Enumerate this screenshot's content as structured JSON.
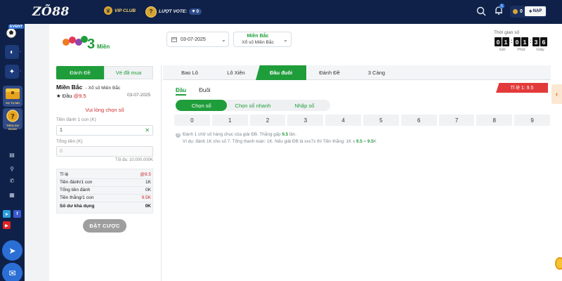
{
  "header": {
    "brand": "ZÕ88",
    "vip_label": "VIP CLUB",
    "vote_label": "LƯỢT VOTE:",
    "vote_count": "0",
    "notification_count": "5",
    "balance": "0",
    "topup_label": "NẠP"
  },
  "siderail": {
    "event_label": "EVENT",
    "promo1_label": "SỰ TỤ MÙ",
    "promo2_label": "THEA DỰ ĐOÁN"
  },
  "lottery": {
    "date": "03-07-2025",
    "region_title": "Miền Bắc",
    "region_sub": "Xổ số Miền Bắc",
    "countdown_label": "Thời gian số",
    "countdown_digits": [
      "0",
      "1",
      "0",
      "1",
      "3",
      "6"
    ],
    "countdown_units": [
      "Giờ",
      "Phút",
      "Giây"
    ]
  },
  "betpanel": {
    "tab_active": "Đánh Đề",
    "tab_inactive": "Vé đã mua",
    "region": "Miền Bắc",
    "region_sub": "- Xổ số Miền Bắc",
    "bet_type_prefix": "★ Đầu",
    "bet_type_rate": "@9.5",
    "date": "03-07-2025",
    "alert": "Vui lòng chọn số",
    "amount_label": "Tiền đánh 1 con (K)",
    "amount_value": "1",
    "total_label": "Tổng tiền (K)",
    "total_placeholder": "0",
    "max_label": "Tối đa: 10.000.000K",
    "summary": [
      {
        "label": "Tỉ lệ",
        "value": "@9.5",
        "red": true
      },
      {
        "label": "Tiền đánh/1 con",
        "value": "1K",
        "red": false
      },
      {
        "label": "Tổng tiền đánh",
        "value": "0K",
        "red": false
      },
      {
        "label": "Tiền thắng/1 con",
        "value": "9.5K",
        "red": true
      },
      {
        "label": "Số dư khả dụng",
        "value": "0K",
        "red": false
      }
    ],
    "submit_label": "ĐẶT CƯỢC"
  },
  "gametabs": [
    "Bao Lô",
    "Lô Xiên",
    "Đầu đuôi",
    "Đánh Đề",
    "3 Càng"
  ],
  "gametab_active": 2,
  "subtabs": [
    "Đầu",
    "Đuôi"
  ],
  "rate_badge": "Tỉ lệ 1: 9.5",
  "pills": [
    "Chọn số",
    "Chọn số nhanh",
    "Nhập số"
  ],
  "digits": [
    "0",
    "1",
    "2",
    "3",
    "4",
    "5",
    "6",
    "7",
    "8",
    "9"
  ],
  "hint": {
    "line1_a": "Đánh 1 chữ số hàng chục của giải ĐB. Thắng gấp",
    "line1_rate": "9.5",
    "line1_b": "lần.",
    "line2_a": "Ví dụ: đánh 1K cho số 7. Tổng thanh toán: 1K. Nếu giải ĐB là xxx7x thì Tiền thắng: 1K x",
    "line2_rate": "9.5",
    "line2_b": "=",
    "line2_win": "9.5",
    "line2_c": "K"
  },
  "colors": {
    "navy": "#0f2148",
    "green": "#1f9d3a",
    "red": "#e23a3a",
    "gold": "#d8a531"
  }
}
